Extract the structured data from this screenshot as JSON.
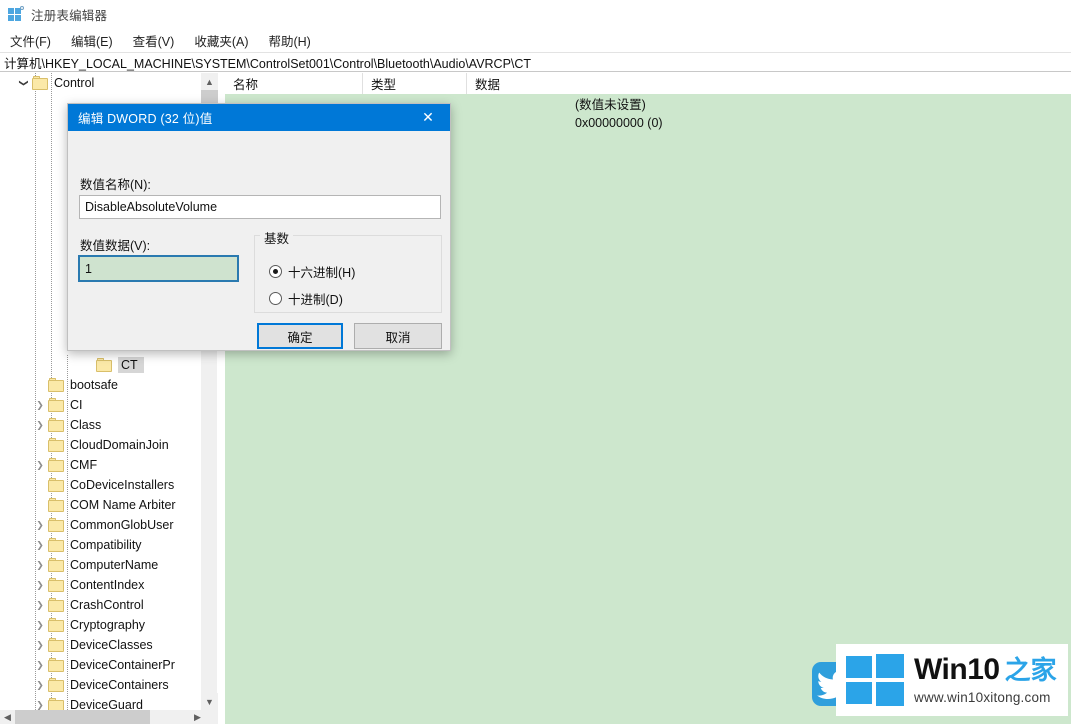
{
  "window": {
    "title": "注册表编辑器",
    "icon": "registry-editor-icon"
  },
  "menubar": {
    "items": [
      {
        "label": "文件(F)",
        "name": "menu-file"
      },
      {
        "label": "编辑(E)",
        "name": "menu-edit"
      },
      {
        "label": "查看(V)",
        "name": "menu-view"
      },
      {
        "label": "收藏夹(A)",
        "name": "menu-favorites"
      },
      {
        "label": "帮助(H)",
        "name": "menu-help"
      }
    ]
  },
  "address": {
    "path": "计算机\\HKEY_LOCAL_MACHINE\\SYSTEM\\ControlSet001\\Control\\Bluetooth\\Audio\\AVRCP\\CT"
  },
  "tree": {
    "nodes": [
      {
        "label": "Control",
        "indent": 1,
        "expander": "expanded",
        "selected": false
      },
      {
        "label": "CT",
        "indent": 5,
        "expander": "none",
        "selected": true
      },
      {
        "label": "bootsafe",
        "indent": 2,
        "expander": "none",
        "selected": false
      },
      {
        "label": "CI",
        "indent": 2,
        "expander": "collapsed",
        "selected": false
      },
      {
        "label": "Class",
        "indent": 2,
        "expander": "collapsed",
        "selected": false
      },
      {
        "label": "CloudDomainJoin",
        "indent": 2,
        "expander": "none",
        "selected": false
      },
      {
        "label": "CMF",
        "indent": 2,
        "expander": "collapsed",
        "selected": false
      },
      {
        "label": "CoDeviceInstallers",
        "indent": 2,
        "expander": "none",
        "selected": false
      },
      {
        "label": "COM Name Arbiter",
        "indent": 2,
        "expander": "none",
        "selected": false
      },
      {
        "label": "CommonGlobUser",
        "indent": 2,
        "expander": "collapsed",
        "selected": false
      },
      {
        "label": "Compatibility",
        "indent": 2,
        "expander": "collapsed",
        "selected": false
      },
      {
        "label": "ComputerName",
        "indent": 2,
        "expander": "collapsed",
        "selected": false
      },
      {
        "label": "ContentIndex",
        "indent": 2,
        "expander": "collapsed",
        "selected": false
      },
      {
        "label": "CrashControl",
        "indent": 2,
        "expander": "collapsed",
        "selected": false
      },
      {
        "label": "Cryptography",
        "indent": 2,
        "expander": "collapsed",
        "selected": false
      },
      {
        "label": "DeviceClasses",
        "indent": 2,
        "expander": "collapsed",
        "selected": false
      },
      {
        "label": "DeviceContainerPr",
        "indent": 2,
        "expander": "collapsed",
        "selected": false
      },
      {
        "label": "DeviceContainers",
        "indent": 2,
        "expander": "collapsed",
        "selected": false
      },
      {
        "label": "DeviceGuard",
        "indent": 2,
        "expander": "collapsed",
        "selected": false
      }
    ],
    "scroll_up_icon": "chevron-up-icon",
    "scroll_down_icon": "chevron-down-icon",
    "scroll_left_icon": "chevron-left-icon",
    "scroll_right_icon": "chevron-right-icon"
  },
  "list": {
    "columns": [
      {
        "label": "名称",
        "name": "column-name"
      },
      {
        "label": "类型",
        "name": "column-type"
      },
      {
        "label": "数据",
        "name": "column-data"
      }
    ],
    "rows": [
      {
        "name": "",
        "type": "",
        "data": "(数值未设置)"
      },
      {
        "name": "",
        "type": "",
        "data": "0x00000000 (0)"
      }
    ]
  },
  "dialog": {
    "title": "编辑 DWORD (32 位)值",
    "close_icon": "close-icon",
    "name_label": "数值名称(N):",
    "name_value": "DisableAbsoluteVolume",
    "data_label": "数值数据(V):",
    "data_value": "1",
    "base_group_label": "基数",
    "radio_hex": "十六进制(H)",
    "radio_dec": "十进制(D)",
    "radio_selected": "hex",
    "ok_label": "确定",
    "cancel_label": "取消"
  },
  "watermark": {
    "brand_main": "Win10",
    "brand_sub": "之家",
    "url": "www.win10xitong.com",
    "logo_icon": "windows-logo-icon",
    "bird_icon": "bird-icon"
  },
  "colors": {
    "accent": "#0078d7",
    "list_background": "#cde7cd",
    "dialog_background": "#f0f0f0",
    "folder": "#fbe9a8",
    "brand_blue": "#2ba4e8"
  }
}
